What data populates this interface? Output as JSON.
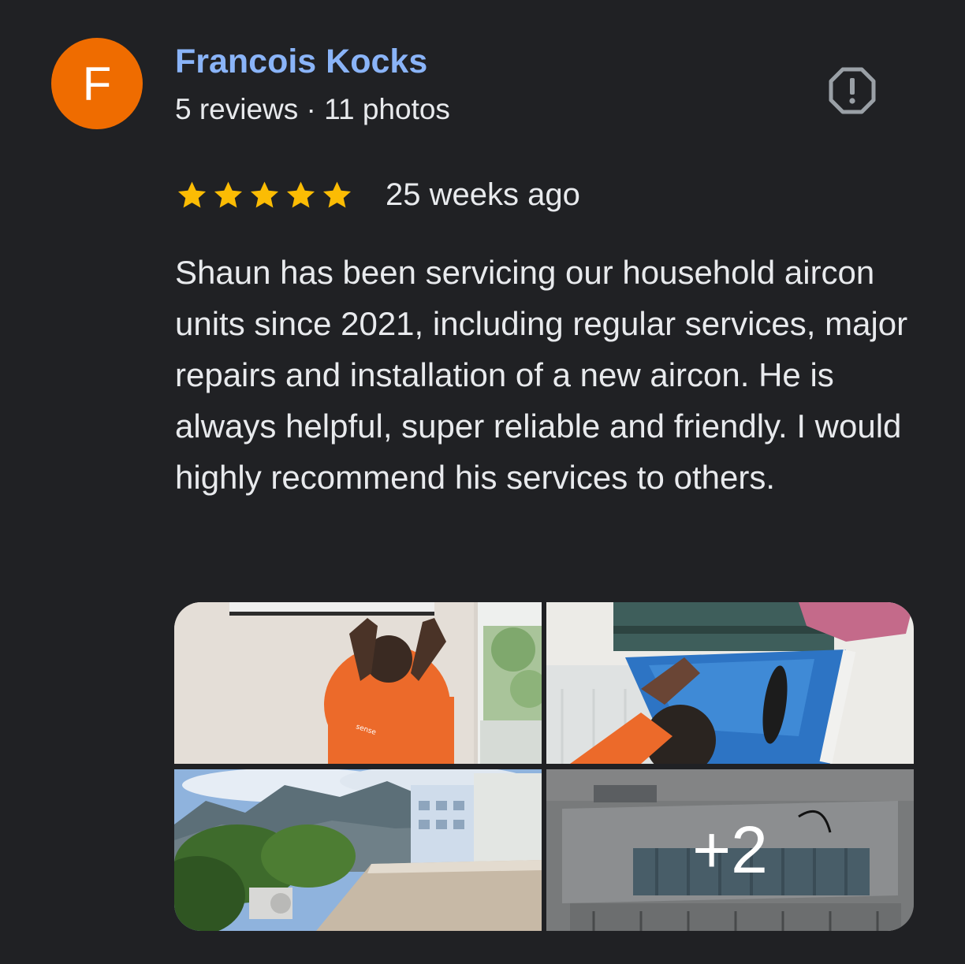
{
  "author": {
    "initial": "F",
    "name": "Francois Kocks",
    "meta": "5 reviews · 11 photos",
    "avatar_color": "#ef6c00"
  },
  "report_icon": "report-flag-octagon-icon",
  "review": {
    "rating": 5,
    "max_rating": 5,
    "date": "25 weeks ago",
    "text": "Shaun has been servicing our household aircon units since 2021, including regular services, major repairs and installation of a new aircon. He is always helpful, super reliable and friendly. I would highly recommend his services to others."
  },
  "photos": {
    "more_count_label": "+2"
  },
  "colors": {
    "background": "#202124",
    "name_link": "#8ab4f8",
    "text": "#e8eaed",
    "star": "#fbbc04"
  }
}
